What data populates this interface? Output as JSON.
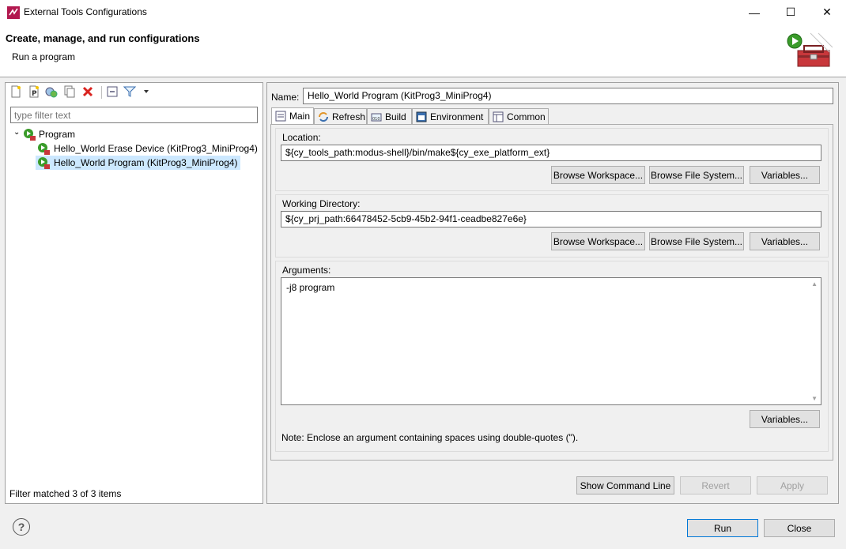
{
  "window": {
    "title": "External Tools Configurations",
    "minimize": "—",
    "maximize": "☐",
    "close": "✕"
  },
  "banner": {
    "title": "Create, manage, and run configurations",
    "subtitle": "Run a program",
    "icon": "toolbox-run-icon"
  },
  "left": {
    "toolbar_icons": [
      "new-config-icon",
      "new-prototype-icon",
      "export-icon",
      "duplicate-icon",
      "delete-icon",
      "collapse-all-icon",
      "filter-icon",
      "view-menu-icon"
    ],
    "filter_placeholder": "type filter text",
    "tree": {
      "root": "Program",
      "items": [
        "Hello_World Erase Device (KitProg3_MiniProg4)",
        "Hello_World Program (KitProg3_MiniProg4)"
      ]
    },
    "status": "Filter matched 3 of 3 items"
  },
  "right": {
    "name_label": "Name:",
    "name_value": "Hello_World Program (KitProg3_MiniProg4)",
    "tabs": [
      "Main",
      "Refresh",
      "Build",
      "Environment",
      "Common"
    ],
    "location": {
      "label": "Location:",
      "value": "${cy_tools_path:modus-shell}/bin/make${cy_exe_platform_ext}",
      "buttons": [
        "Browse Workspace...",
        "Browse File System...",
        "Variables..."
      ]
    },
    "working_dir": {
      "label": "Working Directory:",
      "value": "${cy_prj_path:66478452-5cb9-45b2-94f1-ceadbe827e6e}",
      "buttons": [
        "Browse Workspace...",
        "Browse File System...",
        "Variables..."
      ]
    },
    "arguments": {
      "label": "Arguments:",
      "value": "-j8 program",
      "variables_button": "Variables...",
      "note": "Note: Enclose an argument containing spaces using double-quotes (\")."
    },
    "buttons": {
      "show_command_line": "Show Command Line",
      "revert": "Revert",
      "apply": "Apply"
    }
  },
  "footer": {
    "run": "Run",
    "close": "Close",
    "help_icon": "help-icon"
  },
  "colors": {
    "selection": "#cce8ff",
    "default_button_border": "#0078d7"
  }
}
